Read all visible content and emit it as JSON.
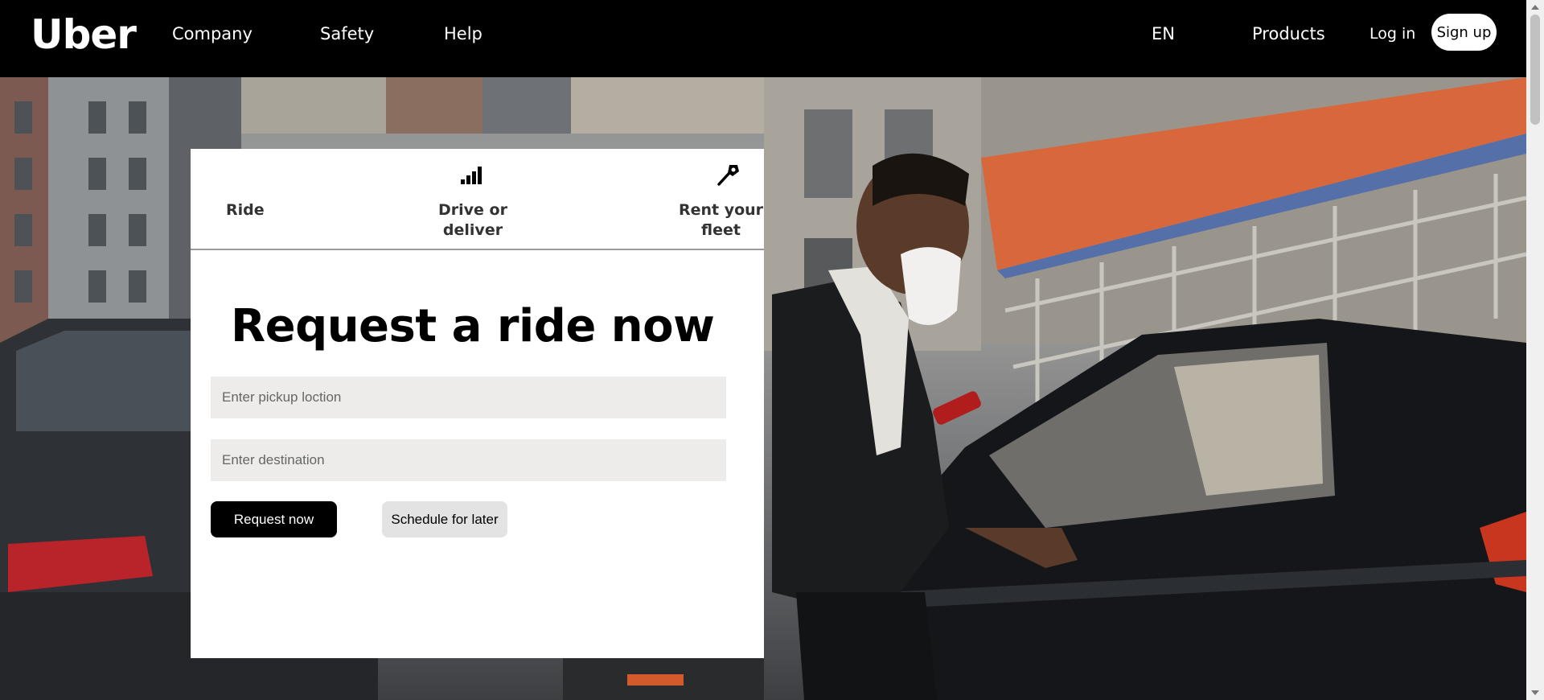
{
  "nav": {
    "logo": "Uber",
    "left_links": [
      "Company",
      "Safety",
      "Help"
    ],
    "language": "EN",
    "products": "Products",
    "login": "Log in",
    "signup": "Sign up"
  },
  "tabs": [
    {
      "label": "Ride",
      "icon": "car-icon"
    },
    {
      "label": "Drive or deliver",
      "line1": "Drive or",
      "line2": "deliver",
      "icon": "signal-bars-icon"
    },
    {
      "label": "Rent your fleet",
      "line1": "Rent your",
      "line2": "fleet",
      "icon": "key-icon"
    }
  ],
  "form": {
    "heading": "Request a ride now",
    "pickup_placeholder": "Enter pickup loction",
    "destination_placeholder": "Enter destination",
    "request_button": "Request now",
    "schedule_button": "Schedule for later"
  },
  "colors": {
    "nav_bg": "#000000",
    "card_bg": "#ffffff",
    "field_bg": "#edecea",
    "primary_button": "#000000",
    "secondary_button": "#e3e3e3"
  }
}
